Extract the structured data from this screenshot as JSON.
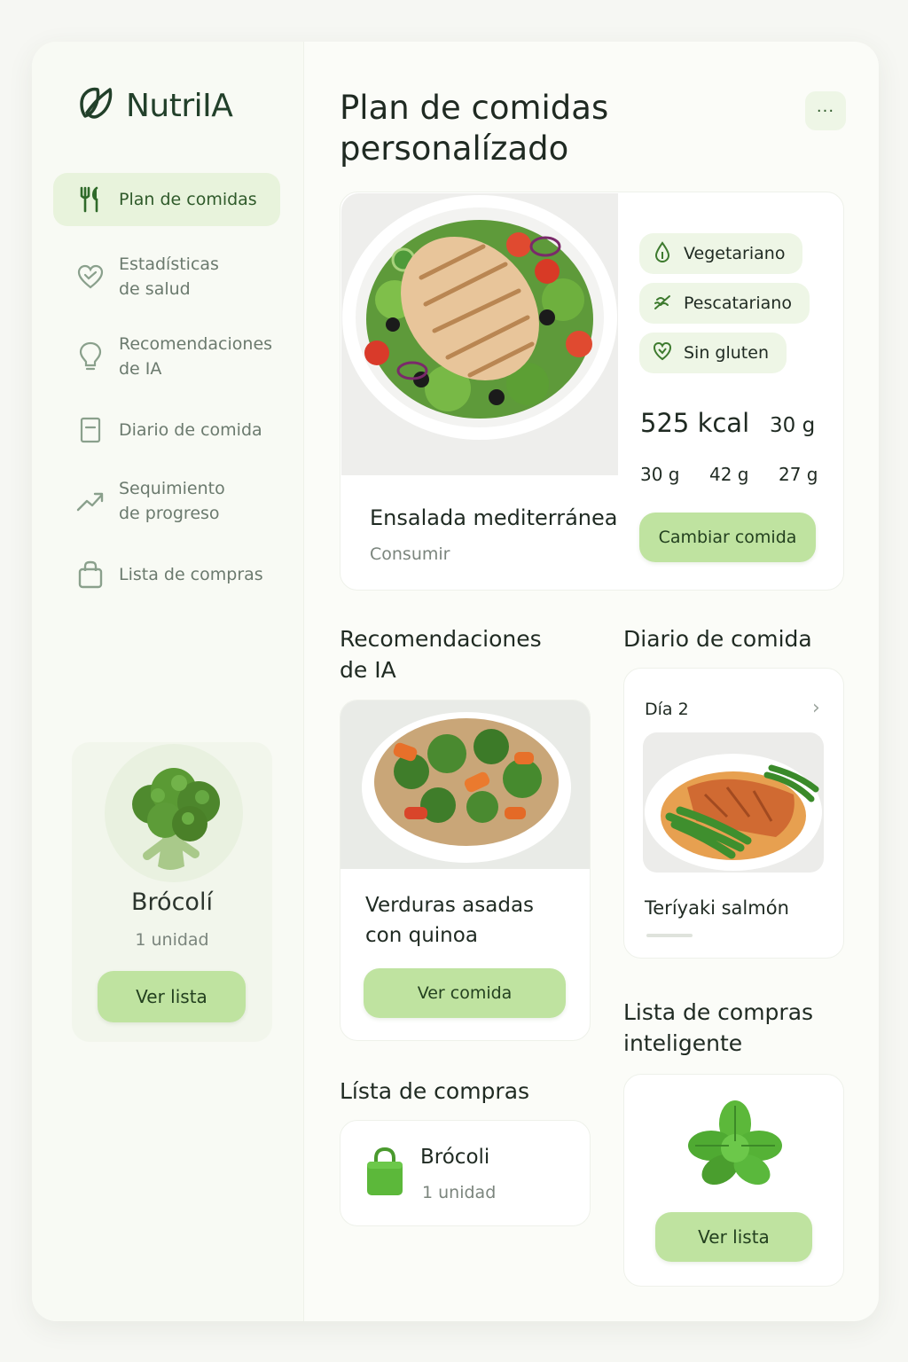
{
  "app": {
    "name": "NutriIA"
  },
  "sidebar": {
    "items": [
      {
        "label": "Plan de comidas",
        "icon": "utensils-icon",
        "active": true
      },
      {
        "label": "Estadísticas\nde salud",
        "icon": "heart-check-icon"
      },
      {
        "label": "Recomendaciones\nde IA",
        "icon": "lightbulb-icon"
      },
      {
        "label": "Diario de comida",
        "icon": "notebook-icon"
      },
      {
        "label": "Sequimiento\nde progreso",
        "icon": "trending-up-icon"
      },
      {
        "label": "Lista de compras",
        "icon": "shopping-bag-icon"
      }
    ],
    "promo": {
      "title": "Brócolí",
      "subtitle": "1 unidad",
      "button": "Ver lista"
    }
  },
  "header": {
    "title": "Plan de comidas personalízado",
    "more_label": "···"
  },
  "hero": {
    "tags": [
      "Vegetariano",
      "Pescatariano",
      "Sin gluten"
    ],
    "calories": "525 kcal",
    "macro_top": "30 g",
    "macros": [
      "30 g",
      "42 g",
      "27 g"
    ],
    "meal_name": "Ensalada mediterránea",
    "meal_sub": "Consumir",
    "button": "Cambiar comida"
  },
  "recommendations": {
    "title": "Recomendaciones\nde IA",
    "meal_name": "Verduras asadas\ncon quinoa",
    "button": "Ver comida"
  },
  "diary": {
    "title": "Diario de comida",
    "day": "Día 2",
    "meal_name": "Teríyaki salmón"
  },
  "shopping": {
    "title": "Lísta de compras",
    "item_name": "Brócoli",
    "item_qty": "1 unidad"
  },
  "smart_list": {
    "title": "Lista de compras\ninteligente",
    "button": "Ver lista"
  },
  "colors": {
    "accent": "#bfe3a0",
    "accent_text": "#23401f",
    "active_bg": "#e8f3dc",
    "brand": "#22402a"
  }
}
